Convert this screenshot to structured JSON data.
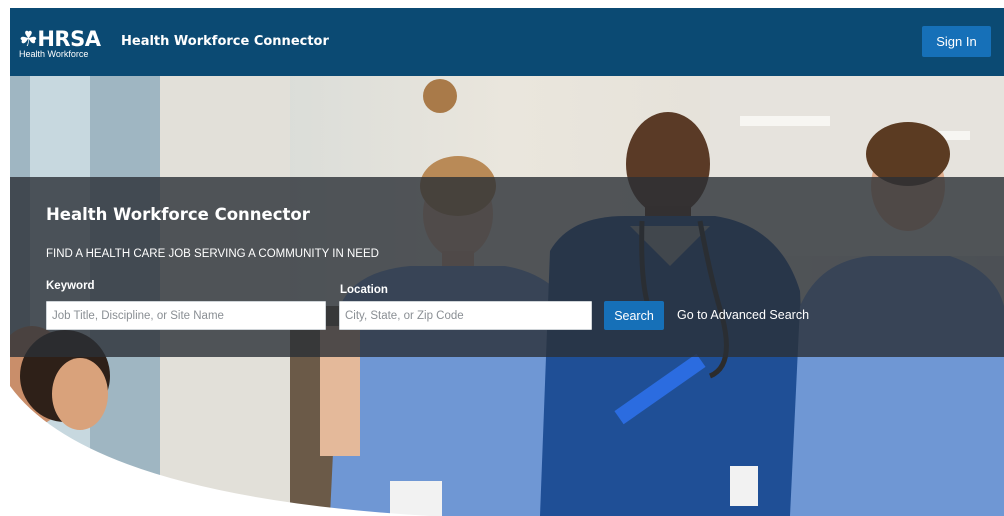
{
  "header": {
    "logo_mark": "HRSA",
    "logo_subtitle": "Health Workforce",
    "site_title": "Health Workforce Connector",
    "signin_label": "Sign In"
  },
  "hero": {
    "title": "Health Workforce Connector",
    "subtitle": "FIND A HEALTH CARE JOB SERVING A COMMUNITY IN NEED",
    "keyword": {
      "label": "Keyword",
      "placeholder": "Job Title, Discipline, or Site Name",
      "value": ""
    },
    "location": {
      "label": "Location",
      "placeholder": "City, State, or Zip Code",
      "value": ""
    },
    "search_label": "Search",
    "advanced_search_label": "Go to Advanced Search"
  },
  "colors": {
    "header_bg": "#0b4a73",
    "button_blue": "#1670b8",
    "overlay": "#2a2f36",
    "scrub_blue": "#6f97d4",
    "scrub_dark_blue": "#1f4f96"
  },
  "icons": {
    "logo": "hrsa-eagle-logo",
    "stethoscope": "stethoscope-decoration"
  }
}
